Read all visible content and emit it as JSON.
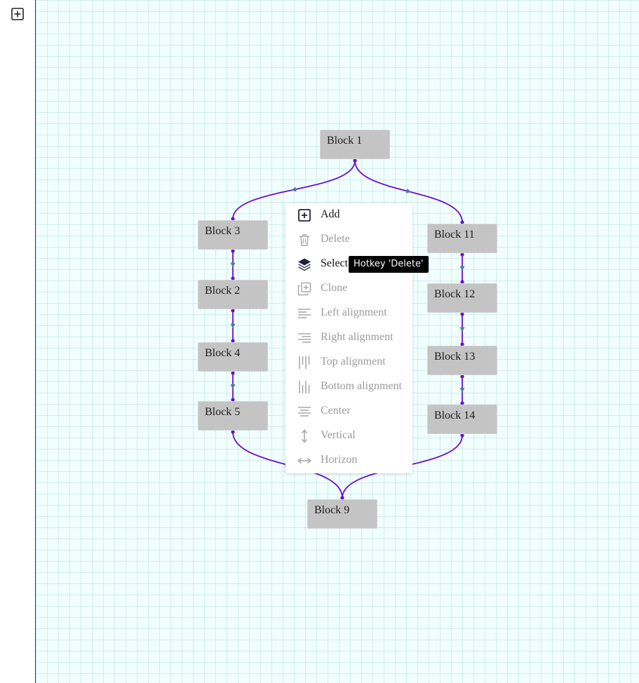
{
  "sidebar": {
    "add_icon": "plus-square-icon"
  },
  "blocks": [
    {
      "id": "b1",
      "label": "Block 1"
    },
    {
      "id": "b3",
      "label": "Block 3"
    },
    {
      "id": "b2",
      "label": "Block 2"
    },
    {
      "id": "b4",
      "label": "Block 4"
    },
    {
      "id": "b5",
      "label": "Block 5"
    },
    {
      "id": "b11",
      "label": "Block 11"
    },
    {
      "id": "b12",
      "label": "Block 12"
    },
    {
      "id": "b13",
      "label": "Block 13"
    },
    {
      "id": "b14",
      "label": "Block 14"
    },
    {
      "id": "b9",
      "label": "Block 9"
    }
  ],
  "edges": [
    {
      "from": "Block 1",
      "to": "Block 3"
    },
    {
      "from": "Block 1",
      "to": "Block 11"
    },
    {
      "from": "Block 3",
      "to": "Block 2"
    },
    {
      "from": "Block 2",
      "to": "Block 4"
    },
    {
      "from": "Block 4",
      "to": "Block 5"
    },
    {
      "from": "Block 11",
      "to": "Block 12"
    },
    {
      "from": "Block 12",
      "to": "Block 13"
    },
    {
      "from": "Block 13",
      "to": "Block 14"
    },
    {
      "from": "Block 5",
      "to": "Block 9"
    },
    {
      "from": "Block 14",
      "to": "Block 9"
    }
  ],
  "context_menu": {
    "items": [
      {
        "label": "Add",
        "icon": "plus-square-icon",
        "enabled": true
      },
      {
        "label": "Delete",
        "icon": "trash-icon",
        "enabled": false
      },
      {
        "label": "Select",
        "icon": "layers-icon",
        "enabled": true
      },
      {
        "label": "Clone",
        "icon": "copy-plus-icon",
        "enabled": false
      },
      {
        "label": "Left alignment",
        "icon": "align-left-icon",
        "enabled": false
      },
      {
        "label": "Right alignment",
        "icon": "align-right-icon",
        "enabled": false
      },
      {
        "label": "Top alignment",
        "icon": "align-top-icon",
        "enabled": false
      },
      {
        "label": "Bottom alignment",
        "icon": "align-bottom-icon",
        "enabled": false
      },
      {
        "label": "Center",
        "icon": "align-center-icon",
        "enabled": false
      },
      {
        "label": "Vertical",
        "icon": "vertical-arrows-icon",
        "enabled": false
      },
      {
        "label": "Horizon",
        "icon": "horizontal-arrows-icon",
        "enabled": false
      }
    ]
  },
  "tooltip": {
    "text": "Hotkey 'Delete'"
  },
  "colors": {
    "edge": "#6a0fd3",
    "arrow": "#4f7e8e",
    "block_fill": "#c4c4c4",
    "canvas_bg": "#f1fefe",
    "icon_enabled": "#23233a",
    "icon_disabled": "#a8a8a8"
  }
}
